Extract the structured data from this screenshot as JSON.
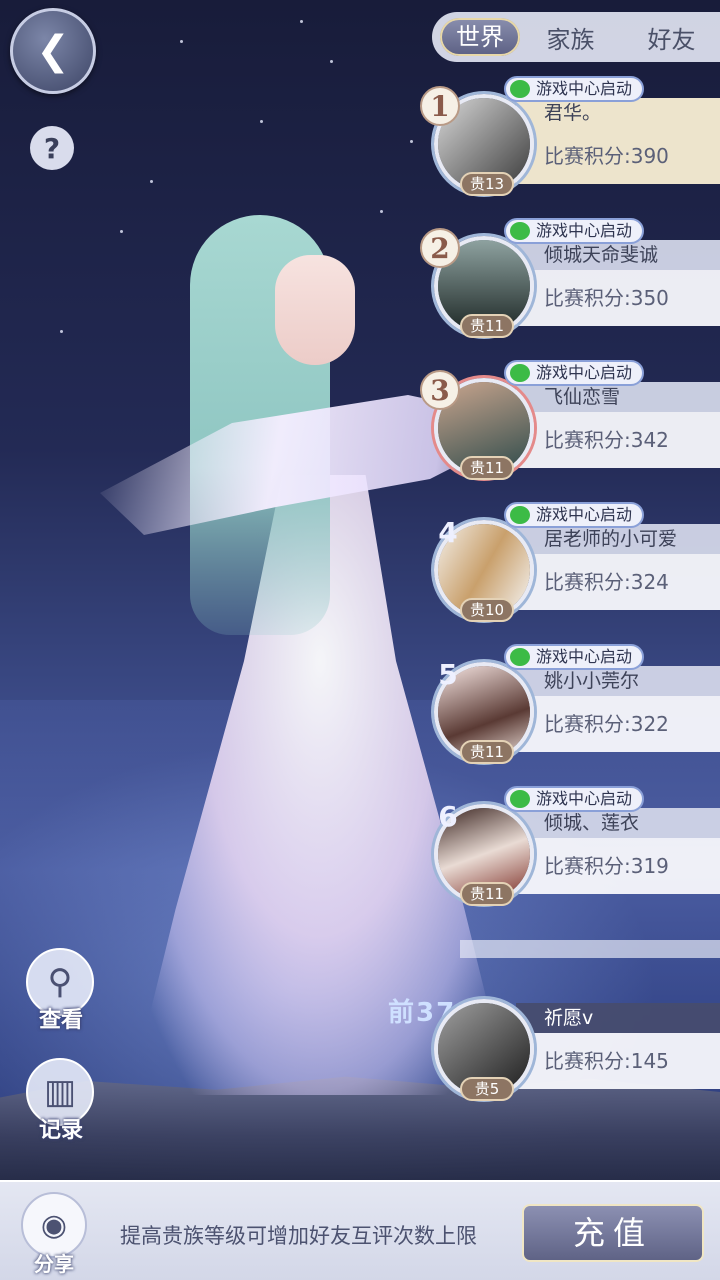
{
  "tabs": [
    {
      "label": "世界",
      "active": true
    },
    {
      "label": "家族",
      "active": false
    },
    {
      "label": "好友",
      "active": false
    }
  ],
  "wechat_badge": "游戏中心启动",
  "ranking": [
    {
      "rank": "1",
      "name": "君华。",
      "score": "比赛积分:390",
      "noble": "贵13"
    },
    {
      "rank": "2",
      "name": "倾城天命斐诚",
      "score": "比赛积分:350",
      "noble": "贵11"
    },
    {
      "rank": "3",
      "name": "飞仙恋雪",
      "score": "比赛积分:342",
      "noble": "贵11"
    },
    {
      "rank": "4",
      "name": "居老师的小可爱",
      "score": "比赛积分:324",
      "noble": "贵10"
    },
    {
      "rank": "5",
      "name": "姚小小莞尔",
      "score": "比赛积分:322",
      "noble": "贵11"
    },
    {
      "rank": "6",
      "name": "倾城、莲衣",
      "score": "比赛积分:319",
      "noble": "贵11"
    }
  ],
  "self": {
    "percentile": "前37%",
    "name": "祈愿v",
    "score": "比赛积分:145",
    "noble": "贵5"
  },
  "tools": {
    "view": "查看",
    "record": "记录",
    "share": "分享"
  },
  "bottom": {
    "tip": "提高贵族等级可增加好友互评次数上限",
    "recharge": "充值"
  },
  "icons": {
    "back": "back-butterfly-icon",
    "help": "question-icon",
    "view": "magnifier-icon",
    "record": "book-icon",
    "share": "camera-icon"
  }
}
